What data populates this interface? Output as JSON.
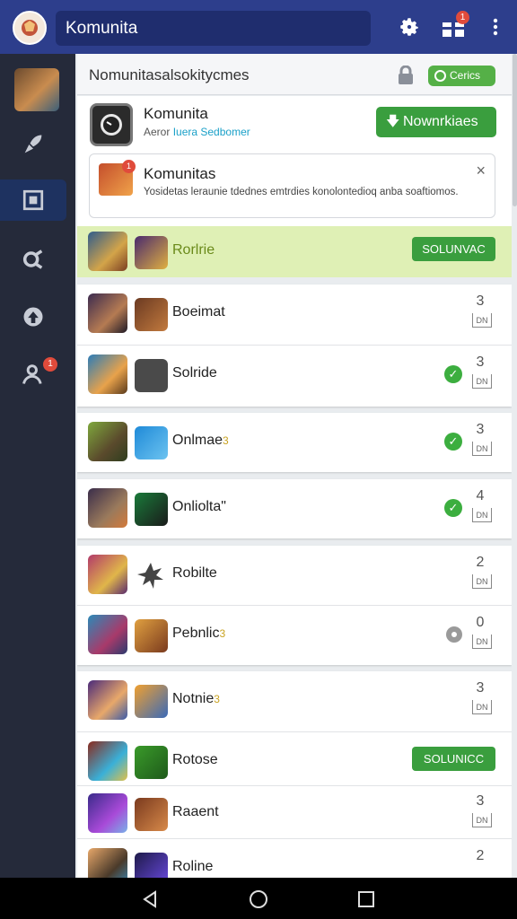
{
  "topbar": {
    "search_text": "Komunita",
    "gift_badge": "1"
  },
  "sidebar": {
    "badge": "1"
  },
  "panel": {
    "title": "Nomunitasalsokitycmes",
    "status_pill": "Cerics"
  },
  "community": {
    "title": "Komunita",
    "sub_prefix": "Aeror ",
    "sub_accent": "Iuera Sedbomer",
    "join_button": "Nownrkiaes"
  },
  "notice": {
    "badge": "1",
    "title": "Komunitas",
    "body": "Yosidetas leraunie tdednes emtrdies konolontedioq anba soaftiomos.",
    "close": "×"
  },
  "featured": {
    "name": "Rorlrie",
    "button": "SOLUNVAC"
  },
  "rows": [
    {
      "name": "Boeimat",
      "suffix": "",
      "count": "3",
      "unit": "DN",
      "status": "none"
    },
    {
      "name": "Solride",
      "suffix": "",
      "count": "3",
      "unit": "DN",
      "status": "check"
    },
    {
      "name": "Onlmae",
      "suffix": "3",
      "count": "3",
      "unit": "DN",
      "status": "check"
    },
    {
      "name": "Onliolta\"",
      "suffix": "",
      "count": "4",
      "unit": "DN",
      "status": "check"
    },
    {
      "name": "Robilte",
      "suffix": "",
      "count": "2",
      "unit": "DN",
      "status": "none"
    },
    {
      "name": "Pebnlic",
      "suffix": "3",
      "count": "0",
      "unit": "DN",
      "status": "pending"
    },
    {
      "name": "Notnie",
      "suffix": "3",
      "count": "3",
      "unit": "DN",
      "status": "none"
    },
    {
      "name": "Rotose",
      "suffix": "",
      "button": "SOLUNICC",
      "status": "button"
    },
    {
      "name": "Raaent",
      "suffix": "",
      "count": "3",
      "unit": "DN",
      "status": "none"
    },
    {
      "name": "Roline",
      "suffix": "",
      "count": "2",
      "unit": "",
      "status": "none"
    }
  ],
  "colors": {
    "topbar": "#2d3e8c",
    "sidebar": "#252a3a",
    "accent_green": "#3a9e3e",
    "featured_bg": "#dff0b5"
  }
}
